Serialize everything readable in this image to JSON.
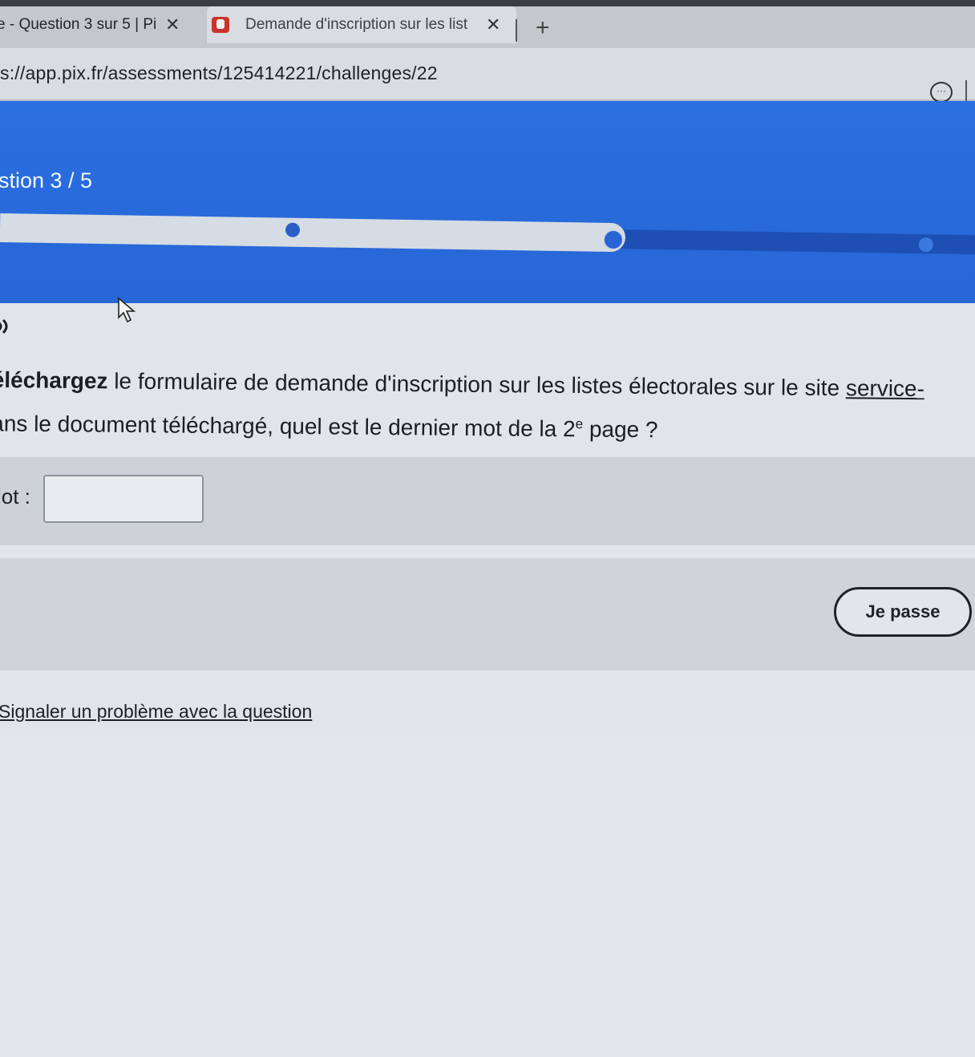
{
  "browser": {
    "tabs": [
      {
        "title": "e - Question 3 sur 5 | Pi",
        "active": true
      },
      {
        "title": "Demande d'inscription sur les list",
        "active": false
      }
    ],
    "url": "s://app.pix.fr/assessments/125414221/challenges/22",
    "more_icon": "···"
  },
  "header": {
    "question_counter": "stion 3 / 5",
    "progress": {
      "current": 3,
      "total": 5
    },
    "colors": {
      "primary": "#2a6fe0",
      "track": "#1d4fb4"
    }
  },
  "challenge": {
    "instruction_line1_bold": "éléchargez",
    "instruction_line1_rest": " le formulaire de demande d'inscription sur les listes électorales sur le site ",
    "instruction_line1_link": "service-",
    "instruction_line2_before": "ans le document téléchargé, quel est le dernier mot de la ",
    "instruction_line2_num": "2",
    "instruction_line2_sup": "e",
    "instruction_line2_after": " page ?",
    "answer_label": "lot :",
    "answer_value": "",
    "skip_label": "Je passe",
    "report_link": "Signaler un problème avec la question"
  }
}
